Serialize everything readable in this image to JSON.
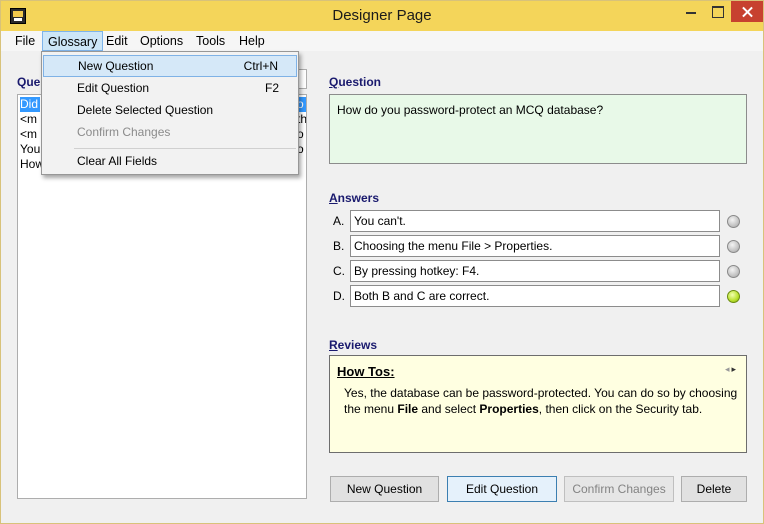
{
  "window": {
    "title": "Designer Page",
    "icon": "app-icon"
  },
  "menubar": {
    "items": [
      "File",
      "Glossary",
      "Edit",
      "Options",
      "Tools",
      "Help"
    ],
    "active": "Glossary"
  },
  "glossary_menu": {
    "items": [
      {
        "label": "New Question",
        "shortcut": "Ctrl+N",
        "highlighted": true,
        "enabled": true
      },
      {
        "label": "Edit Question",
        "shortcut": "F2",
        "highlighted": false,
        "enabled": true
      },
      {
        "label": "Delete Selected Question",
        "shortcut": "",
        "highlighted": false,
        "enabled": true
      },
      {
        "label": "Confirm Changes",
        "shortcut": "",
        "highlighted": false,
        "enabled": false
      },
      {
        "label": "Clear All Fields",
        "shortcut": "",
        "highlighted": false,
        "enabled": true
      }
    ]
  },
  "left_panel": {
    "label": "Que",
    "list_left": [
      "Did",
      "<m",
      "<m",
      "You",
      "How"
    ],
    "list_right": [
      "o",
      "th",
      "o",
      "o"
    ]
  },
  "question": {
    "label": "Question",
    "text": "How do you password-protect an MCQ database?"
  },
  "answers": {
    "label": "Answers",
    "items": [
      {
        "letter": "A.",
        "text": "You can't.",
        "correct": false
      },
      {
        "letter": "B.",
        "text": "Choosing the menu File > Properties.",
        "correct": false
      },
      {
        "letter": "C.",
        "text": "By pressing hotkey: F4.",
        "correct": false
      },
      {
        "letter": "D.",
        "text": "Both B and C are correct.",
        "correct": true
      }
    ]
  },
  "reviews": {
    "label": "Reviews",
    "title": "How Tos:",
    "text_1": "Yes, the database can be password-protected. You can do so by choosing the menu ",
    "bold_1": "File",
    "text_2": " and select ",
    "bold_2": "Properties",
    "text_3": ", then click on the Security tab.",
    "nav_prev": "◂",
    "nav_next": "▸"
  },
  "buttons": {
    "new_question": "New Question",
    "edit_question": "Edit Question",
    "confirm_changes": "Confirm Changes",
    "delete": "Delete"
  },
  "colors": {
    "titlebar": "#f4d55a",
    "question_bg": "#e8f9e8",
    "review_bg": "#ffffe1",
    "selection": "#3399ff",
    "close": "#c7412f"
  }
}
